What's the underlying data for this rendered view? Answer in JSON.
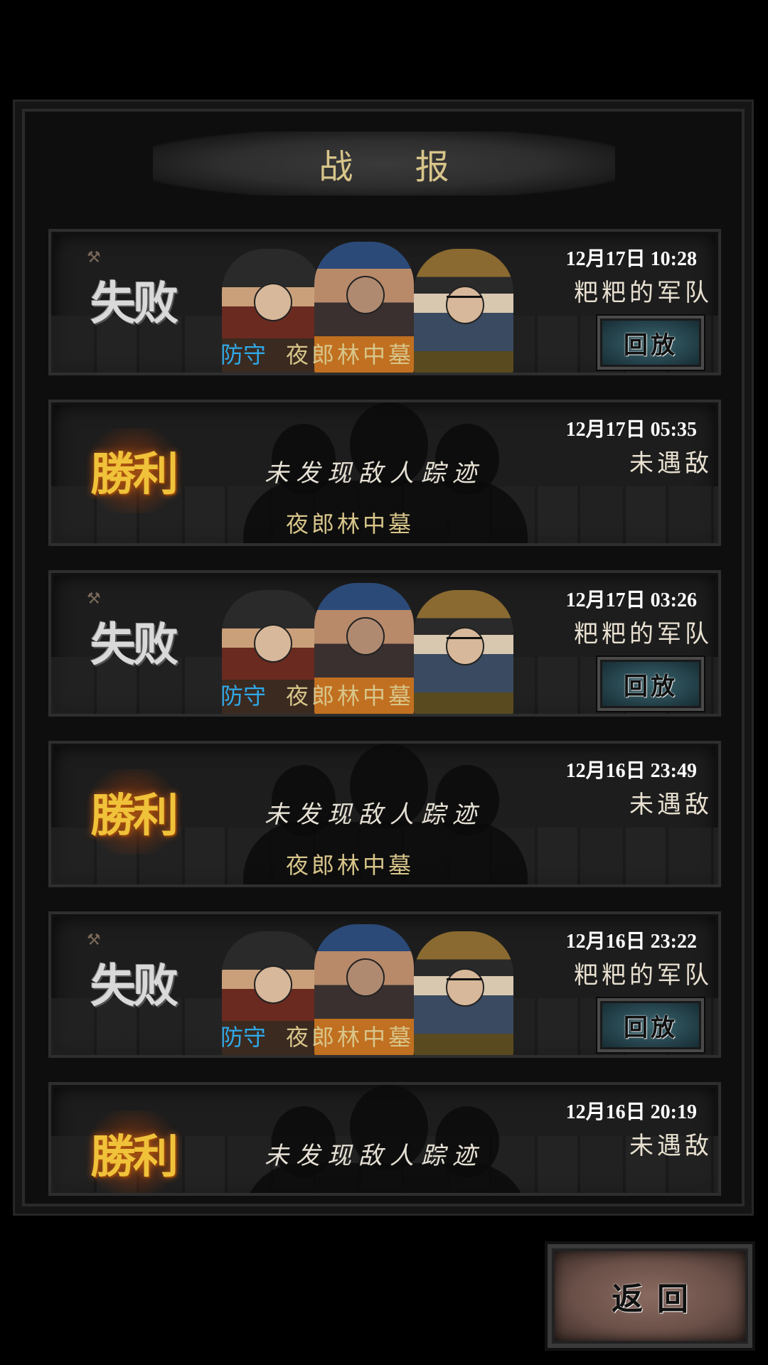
{
  "title": "战 报",
  "records": [
    {
      "result": "失败",
      "type": "lose",
      "time": "12月17日 10:28",
      "opponent": "粑粑的军队",
      "mode": "防守",
      "location": "夜郎林中墓",
      "replay": "回放"
    },
    {
      "result": "勝利",
      "type": "win",
      "time": "12月17日 05:35",
      "opponent": "未遇敌",
      "message": "未发现敌人踪迹",
      "location": "夜郎林中墓"
    },
    {
      "result": "失败",
      "type": "lose",
      "time": "12月17日 03:26",
      "opponent": "粑粑的军队",
      "mode": "防守",
      "location": "夜郎林中墓",
      "replay": "回放"
    },
    {
      "result": "勝利",
      "type": "win",
      "time": "12月16日 23:49",
      "opponent": "未遇敌",
      "message": "未发现敌人踪迹",
      "location": "夜郎林中墓"
    },
    {
      "result": "失败",
      "type": "lose",
      "time": "12月16日 23:22",
      "opponent": "粑粑的军队",
      "mode": "防守",
      "location": "夜郎林中墓",
      "replay": "回放"
    },
    {
      "result": "勝利",
      "type": "win",
      "time": "12月16日 20:19",
      "opponent": "未遇敌",
      "message": "未发现敌人踪迹",
      "location": ""
    }
  ],
  "back_label": "返回",
  "colors": {
    "gold": "#d8c58a",
    "defense_blue": "#30a8e8",
    "win_orange": "#f0c23a"
  }
}
